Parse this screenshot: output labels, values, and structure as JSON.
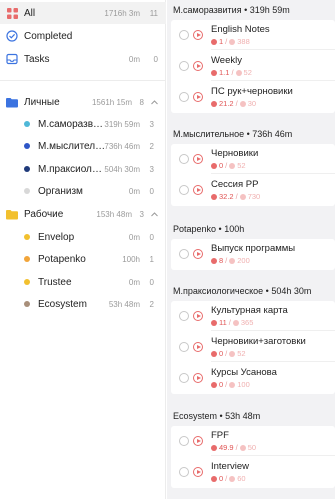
{
  "sidebar": {
    "all": {
      "label": "All",
      "time": "1716h 3m",
      "count": "11"
    },
    "completed": {
      "label": "Completed"
    },
    "tasks": {
      "label": "Tasks",
      "time": "0m",
      "count": "0"
    },
    "groups": [
      {
        "label": "Личные",
        "time": "1561h 15m",
        "count": "8",
        "color": "#3b73e0",
        "items": [
          {
            "label": "М.саморазвити...",
            "time": "319h 59m",
            "count": "3",
            "color": "#4fb8d8"
          },
          {
            "label": "М.мыслительн...",
            "time": "736h 46m",
            "count": "2",
            "color": "#2e56c7"
          },
          {
            "label": "М.праксиологи...",
            "time": "504h 30m",
            "count": "3",
            "color": "#1f3a7a"
          },
          {
            "label": "Организм",
            "time": "0m",
            "count": "0",
            "color": "#d8d8d8"
          }
        ]
      },
      {
        "label": "Рабочие",
        "time": "153h 48m",
        "count": "3",
        "color": "#f2c02e",
        "items": [
          {
            "label": "Envelop",
            "time": "0m",
            "count": "0",
            "color": "#f2c02e"
          },
          {
            "label": "Potapenko",
            "time": "100h",
            "count": "1",
            "color": "#f2a53a"
          },
          {
            "label": "Trustee",
            "time": "0m",
            "count": "0",
            "color": "#f2c02e"
          },
          {
            "label": "Ecosystem",
            "time": "53h 48m",
            "count": "2",
            "color": "#a88f7a"
          }
        ]
      }
    ]
  },
  "sections": [
    {
      "title": "М.саморазвития • 319h 59m",
      "tasks": [
        {
          "name": "English Notes",
          "spent": "1",
          "est": "388"
        },
        {
          "name": "Weekly",
          "spent": "1.1",
          "est": "52"
        },
        {
          "name": "ПС рук+черновики",
          "spent": "21.2",
          "est": "30"
        }
      ]
    },
    {
      "title": "М.мыслительное • 736h 46m",
      "tasks": [
        {
          "name": "Черновики",
          "spent": "0",
          "est": "52"
        },
        {
          "name": "Сессия РР",
          "spent": "32.2",
          "est": "730"
        }
      ]
    },
    {
      "title": "Potapenko • 100h",
      "tasks": [
        {
          "name": "Выпуск программы",
          "spent": "8",
          "est": "200"
        }
      ]
    },
    {
      "title": "М.праксиологическое • 504h 30m",
      "tasks": [
        {
          "name": "Культурная карта",
          "spent": "11",
          "est": "365"
        },
        {
          "name": "Черновики+заготовки",
          "spent": "0",
          "est": "52"
        },
        {
          "name": "Курсы Усанова",
          "spent": "0",
          "est": "100"
        }
      ]
    },
    {
      "title": "Ecosystem • 53h 48m",
      "tasks": [
        {
          "name": "FPF",
          "spent": "49.9",
          "est": "50"
        },
        {
          "name": "Interview",
          "spent": "0",
          "est": "60"
        }
      ]
    }
  ],
  "colors": {
    "accent": "#e86b6b",
    "all_icon": "#e86b6b",
    "completed_icon": "#3b73e0",
    "tasks_icon": "#3b73e0"
  }
}
